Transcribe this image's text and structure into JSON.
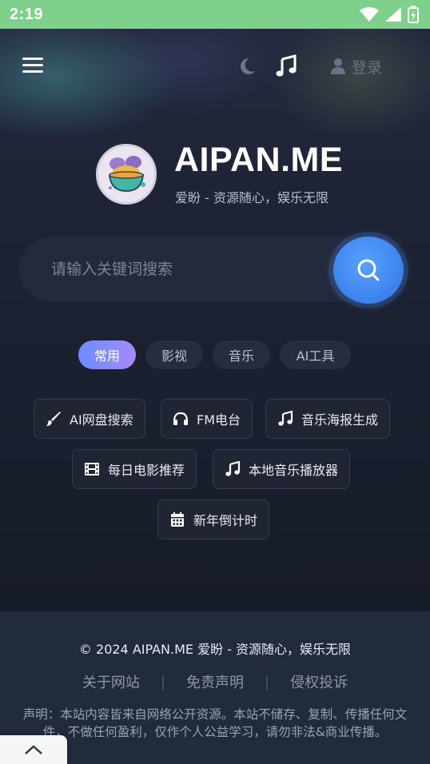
{
  "status_bar": {
    "time": "2:19"
  },
  "header": {
    "login_label": "登录"
  },
  "brand": {
    "title": "AIPAN.ME",
    "subtitle": "爱盼 - 资源随心，娱乐无限"
  },
  "search": {
    "placeholder": "请输入关键词搜索",
    "value": ""
  },
  "tabs": [
    {
      "label": "常用",
      "active": true
    },
    {
      "label": "影视",
      "active": false
    },
    {
      "label": "音乐",
      "active": false
    },
    {
      "label": "AI工具",
      "active": false
    }
  ],
  "tools": [
    {
      "label": "AI网盘搜索",
      "icon": "brush-icon"
    },
    {
      "label": "FM电台",
      "icon": "headphones-icon"
    },
    {
      "label": "音乐海报生成",
      "icon": "music-note-icon"
    },
    {
      "label": "每日电影推荐",
      "icon": "film-icon"
    },
    {
      "label": "本地音乐播放器",
      "icon": "music-note-icon"
    },
    {
      "label": "新年倒计时",
      "icon": "calendar-icon"
    }
  ],
  "footer": {
    "copyright": "© 2024 AIPAN.ME 爱盼 - 资源随心，娱乐无限",
    "links": [
      "关于网站",
      "免责声明",
      "侵权投诉"
    ],
    "disclaimer": "声明：本站内容皆来自网络公开资源。本站不储存、复制、传播任何文件，不做任何盈利，仅作个人公益学习，请勿非法&商业传播。"
  },
  "colors": {
    "status_bar": "#7fd08a",
    "background": "#1a2030",
    "accent_blue": "#3f86f0",
    "tab_active_start": "#6b8cff",
    "tab_active_end": "#a78bfa"
  }
}
